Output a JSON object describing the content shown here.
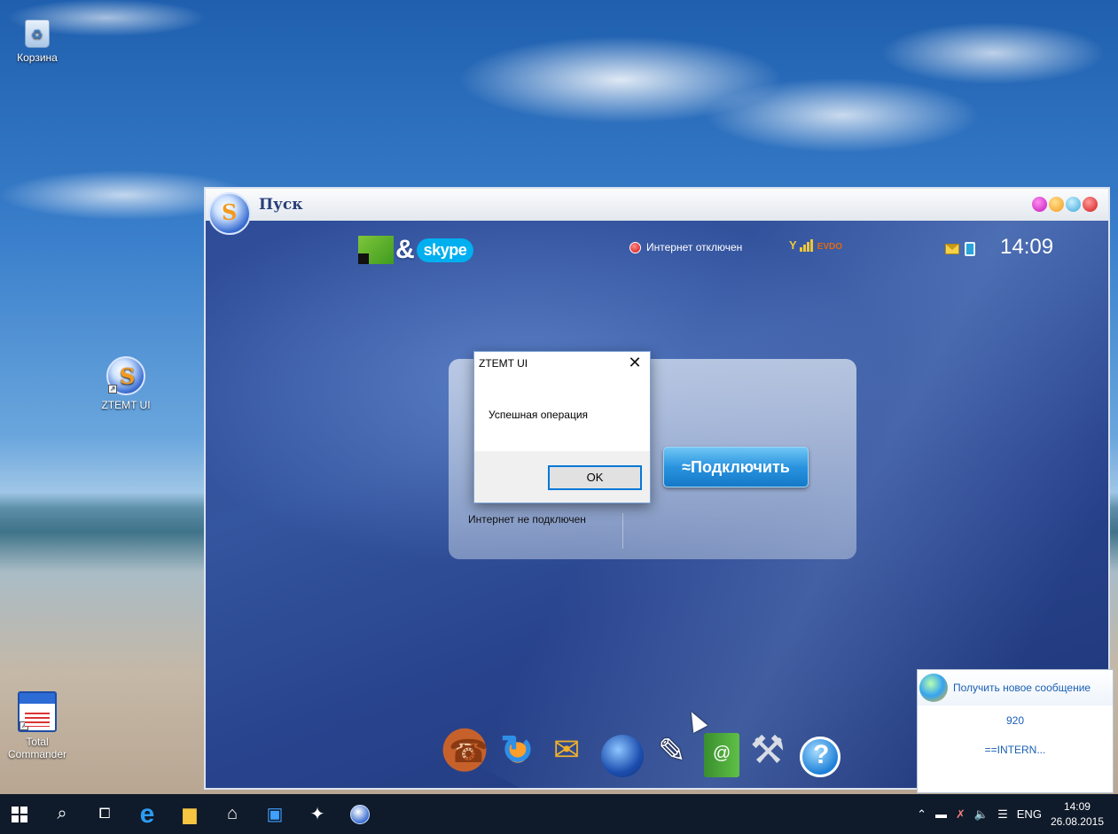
{
  "desktop": {
    "icons": [
      {
        "label": "Корзина",
        "icon": "recycle-bin-icon"
      },
      {
        "label": "ZTEMT UI",
        "icon": "ztemt-app-icon"
      },
      {
        "label": "Total\nCommander",
        "icon": "total-commander-icon"
      }
    ]
  },
  "app": {
    "title": "Пуск",
    "window_controls": [
      "minimize-dot",
      "restore-dot",
      "maximize-dot",
      "close-dot"
    ],
    "brand": {
      "amp": "&",
      "skype": "skype"
    },
    "internet_status": "Интернет отключен",
    "network_type": "EVDO",
    "clock": "14:09",
    "connection_status": "Интернет не подключен",
    "connect_button": "≈Подключить",
    "dock": [
      "phone-icon",
      "sync-icon",
      "mailbox-icon",
      "globe-icon",
      "note-icon",
      "contacts-book-icon",
      "tools-icon",
      "help-icon"
    ]
  },
  "dialog": {
    "title": "ZTEMT UI",
    "message": "Успешная операция",
    "ok_label": "OK",
    "close_glyph": "✕"
  },
  "notification": {
    "title": "Получить новое сообщение",
    "sender": "920",
    "preview": "==INTERN..."
  },
  "taskbar": {
    "apps": [
      "start-icon",
      "search-icon",
      "task-view-icon",
      "edge-icon",
      "file-explorer-icon",
      "store-icon",
      "photos-icon",
      "flash-icon",
      "ztemt-icon"
    ],
    "language": "ENG",
    "time": "14:09",
    "date": "26.08.2015"
  },
  "colors": {
    "accent": "#0078d7",
    "connect_button": "#2a93df",
    "notification_text": "#1a5fb4",
    "taskbar": "#0f1a2a"
  }
}
